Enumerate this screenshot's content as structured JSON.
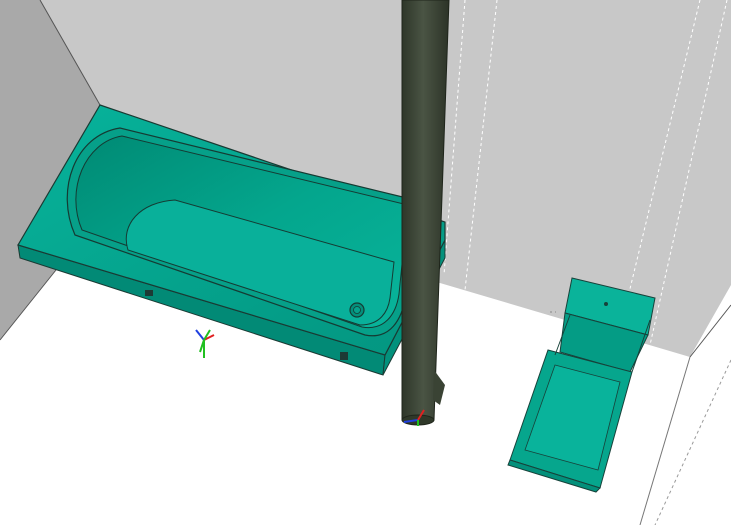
{
  "viewport": {
    "colors": {
      "background": "#ffffff",
      "wall_left": "#a9a9a9",
      "wall_back": "#c8c8c8",
      "bathtub": "#05a58e",
      "bathtub_inner": "#028a76",
      "toilet": "#07a88f",
      "pipe": "#3c4535",
      "edge": "#2a2a2a",
      "hidden_edge": "#ffffff"
    },
    "objects": [
      {
        "name": "left-wall",
        "icon": "wall-icon"
      },
      {
        "name": "back-wall",
        "icon": "wall-icon"
      },
      {
        "name": "bathtub",
        "icon": "bathtub-icon"
      },
      {
        "name": "vertical-pipe",
        "icon": "pipe-icon"
      },
      {
        "name": "toilet",
        "icon": "toilet-icon"
      }
    ],
    "gizmos": [
      {
        "name": "axis-gizmo-bathtub",
        "axes": [
          "x",
          "y",
          "z"
        ],
        "colors": {
          "x": "#e02020",
          "y": "#20c020",
          "z": "#2040e0"
        }
      },
      {
        "name": "axis-gizmo-pipe",
        "axes": [
          "x",
          "y",
          "z"
        ],
        "colors": {
          "x": "#e02020",
          "y": "#20c020",
          "z": "#2040e0"
        }
      }
    ]
  }
}
